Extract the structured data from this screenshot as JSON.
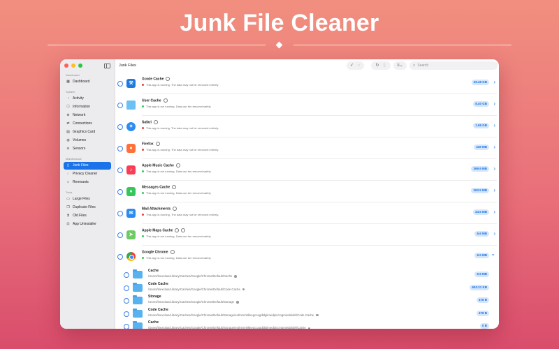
{
  "hero": {
    "title": "Junk File Cleaner"
  },
  "window": {
    "title": "Junk Files"
  },
  "search": {
    "placeholder": "Search"
  },
  "sidebar": {
    "sections": [
      {
        "label": "Dashboard",
        "items": [
          {
            "label": "Dashboard",
            "icon": "dashboard-icon"
          }
        ]
      },
      {
        "label": "System",
        "items": [
          {
            "label": "Activity",
            "icon": "activity-icon"
          },
          {
            "label": "Information",
            "icon": "info-icon"
          },
          {
            "label": "Network",
            "icon": "globe-icon"
          },
          {
            "label": "Connections",
            "icon": "connections-icon"
          },
          {
            "label": "Graphics Card",
            "icon": "graphics-card-icon"
          },
          {
            "label": "Volumes",
            "icon": "volumes-icon"
          },
          {
            "label": "Sensors",
            "icon": "sensors-icon"
          }
        ]
      },
      {
        "label": "Maintenance",
        "items": [
          {
            "label": "Junk Files",
            "icon": "trash-icon",
            "active": true
          },
          {
            "label": "Privacy Cleaner",
            "icon": "privacy-icon"
          },
          {
            "label": "Remnants",
            "icon": "remnants-icon"
          }
        ]
      },
      {
        "label": "Tools",
        "items": [
          {
            "label": "Large Files",
            "icon": "large-files-icon"
          },
          {
            "label": "Duplicate Files",
            "icon": "duplicate-files-icon"
          },
          {
            "label": "Old Files",
            "icon": "hourglass-icon"
          },
          {
            "label": "App Uninstaller",
            "icon": "uninstaller-icon"
          }
        ]
      }
    ]
  },
  "junk_items": [
    {
      "name": "Xcode Cache",
      "status": "This app is running. The data may not be removed entirely.",
      "running": true,
      "size": "49.48 GB",
      "icon": "xcode-icon",
      "expanded": false
    },
    {
      "name": "User Cache",
      "status": "This app is not running. Data can be removed safely.",
      "running": false,
      "size": "8.40 GB",
      "icon": "folder-icon",
      "expanded": false
    },
    {
      "name": "Safari",
      "status": "This app is running. The data may not be removed entirely.",
      "running": true,
      "size": "1.69 GB",
      "icon": "safari-icon",
      "expanded": false
    },
    {
      "name": "Firefox",
      "status": "This app is running. The data may not be removed entirely.",
      "running": true,
      "size": "449 MB",
      "icon": "firefox-icon",
      "expanded": false
    },
    {
      "name": "Apple Music Cache",
      "status": "This app is not running. Data can be removed safely.",
      "running": false,
      "size": "369.9 MB",
      "icon": "music-icon",
      "expanded": false
    },
    {
      "name": "Messages Cache",
      "status": "This app is not running. Data can be removed safely.",
      "running": false,
      "size": "263.5 MB",
      "icon": "messages-icon",
      "expanded": false
    },
    {
      "name": "Mail Attachments",
      "status": "This app is running. The data may not be removed entirely.",
      "running": true,
      "size": "34.6 MB",
      "icon": "mail-icon",
      "expanded": false
    },
    {
      "name": "Apple Maps Cache",
      "status": "This app is not running. Data can be removed safely.",
      "running": false,
      "size": "6.6 MB",
      "icon": "maps-icon",
      "expanded": false,
      "locked": true
    },
    {
      "name": "Google Chrome",
      "status": "This app is not running. Data can be removed safely.",
      "running": false,
      "size": "6.5 MB",
      "icon": "chrome-icon",
      "expanded": true
    }
  ],
  "chrome_subitems": [
    {
      "name": "Cache",
      "path": "/Users/lnexcitus/Library/Caches/Google/Chrome/Default/Cache",
      "size": "5.9 MB"
    },
    {
      "name": "Code Cache",
      "path": "/Users/lnexcitus/Library/Caches/Google/Chrome/Default/Code Cache",
      "size": "653.21 KB"
    },
    {
      "name": "Storage",
      "path": "/Users/lnexcitus/Library/Caches/Google/Chrome/Default/Storage",
      "size": "478 B"
    },
    {
      "name": "Code Cache",
      "path": "/Users/lnexcitus/Library/Caches/Google/Chrome/Default/Storage/ext/nmmhkkegccagdldgiimedpiccmgmieda/def/Code Cache",
      "size": "478 B"
    },
    {
      "name": "Cache",
      "path": "/Users/lnexcitus/Library/Caches/Google/Chrome/Default/Storage/ext/nmmhkkegccagdldgiimedpiccmgmieda/def/Cache",
      "size": "0 B"
    }
  ],
  "colors": {
    "accent": "#1a73e8",
    "running": "#e5403b",
    "safe": "#34c759",
    "pill_bg": "#d4e6fb"
  }
}
